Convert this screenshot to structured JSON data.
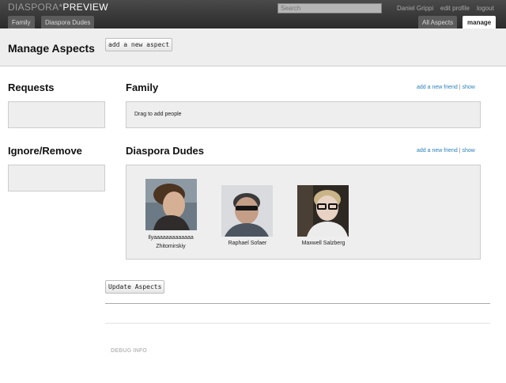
{
  "header": {
    "logo_part1": "DIASPORA*",
    "logo_part2": "PREVIEW",
    "search_placeholder": "Search",
    "user_name": "Daniel Grippi",
    "edit_profile": "edit profile",
    "logout": "logout",
    "left_tabs": [
      "Family",
      "Diaspora Dudes"
    ],
    "all_aspects": "All Aspects",
    "manage": "manage"
  },
  "page": {
    "title": "Manage Aspects",
    "add_aspect_button": "add a new aspect"
  },
  "sidebar": {
    "requests_title": "Requests",
    "ignore_title": "Ignore/Remove"
  },
  "aspects": [
    {
      "name": "Family",
      "add_friend": "add a new friend",
      "separator": "|",
      "show": "show",
      "empty_text": "Drag to add people"
    },
    {
      "name": "Diaspora Dudes",
      "add_friend": "add a new friend",
      "separator": "|",
      "show": "show",
      "people": [
        {
          "name_line1": "Ilyaaaaaaaaaaaaa",
          "name_line2": "Zhitomirskiy"
        },
        {
          "name_line1": "Raphael Sofaer",
          "name_line2": ""
        },
        {
          "name_line1": "Maxwell Salzberg",
          "name_line2": ""
        }
      ]
    }
  ],
  "footer": {
    "update_button": "Update Aspects",
    "debug": "DEBUG INFO"
  },
  "colors": {
    "header_bg": "#2b2b2b",
    "band_bg": "#eeeeee",
    "link": "#2a80b9"
  }
}
